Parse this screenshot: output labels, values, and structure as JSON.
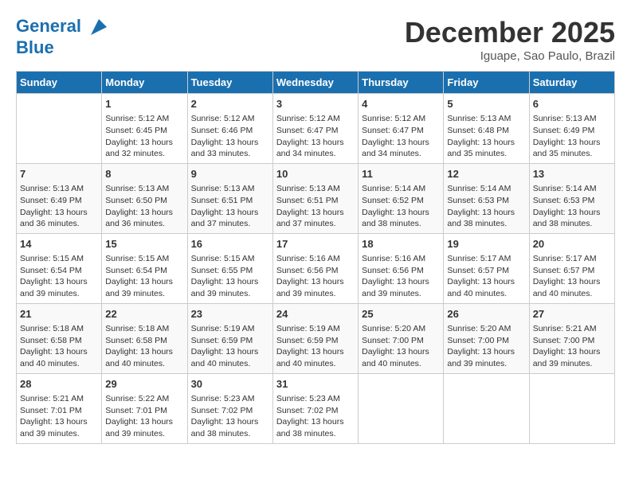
{
  "header": {
    "logo_line1": "General",
    "logo_line2": "Blue",
    "month": "December 2025",
    "location": "Iguape, Sao Paulo, Brazil"
  },
  "weekdays": [
    "Sunday",
    "Monday",
    "Tuesday",
    "Wednesday",
    "Thursday",
    "Friday",
    "Saturday"
  ],
  "weeks": [
    [
      {
        "day": "",
        "info": ""
      },
      {
        "day": "1",
        "info": "Sunrise: 5:12 AM\nSunset: 6:45 PM\nDaylight: 13 hours\nand 32 minutes."
      },
      {
        "day": "2",
        "info": "Sunrise: 5:12 AM\nSunset: 6:46 PM\nDaylight: 13 hours\nand 33 minutes."
      },
      {
        "day": "3",
        "info": "Sunrise: 5:12 AM\nSunset: 6:47 PM\nDaylight: 13 hours\nand 34 minutes."
      },
      {
        "day": "4",
        "info": "Sunrise: 5:12 AM\nSunset: 6:47 PM\nDaylight: 13 hours\nand 34 minutes."
      },
      {
        "day": "5",
        "info": "Sunrise: 5:13 AM\nSunset: 6:48 PM\nDaylight: 13 hours\nand 35 minutes."
      },
      {
        "day": "6",
        "info": "Sunrise: 5:13 AM\nSunset: 6:49 PM\nDaylight: 13 hours\nand 35 minutes."
      }
    ],
    [
      {
        "day": "7",
        "info": "Sunrise: 5:13 AM\nSunset: 6:49 PM\nDaylight: 13 hours\nand 36 minutes."
      },
      {
        "day": "8",
        "info": "Sunrise: 5:13 AM\nSunset: 6:50 PM\nDaylight: 13 hours\nand 36 minutes."
      },
      {
        "day": "9",
        "info": "Sunrise: 5:13 AM\nSunset: 6:51 PM\nDaylight: 13 hours\nand 37 minutes."
      },
      {
        "day": "10",
        "info": "Sunrise: 5:13 AM\nSunset: 6:51 PM\nDaylight: 13 hours\nand 37 minutes."
      },
      {
        "day": "11",
        "info": "Sunrise: 5:14 AM\nSunset: 6:52 PM\nDaylight: 13 hours\nand 38 minutes."
      },
      {
        "day": "12",
        "info": "Sunrise: 5:14 AM\nSunset: 6:53 PM\nDaylight: 13 hours\nand 38 minutes."
      },
      {
        "day": "13",
        "info": "Sunrise: 5:14 AM\nSunset: 6:53 PM\nDaylight: 13 hours\nand 38 minutes."
      }
    ],
    [
      {
        "day": "14",
        "info": "Sunrise: 5:15 AM\nSunset: 6:54 PM\nDaylight: 13 hours\nand 39 minutes."
      },
      {
        "day": "15",
        "info": "Sunrise: 5:15 AM\nSunset: 6:54 PM\nDaylight: 13 hours\nand 39 minutes."
      },
      {
        "day": "16",
        "info": "Sunrise: 5:15 AM\nSunset: 6:55 PM\nDaylight: 13 hours\nand 39 minutes."
      },
      {
        "day": "17",
        "info": "Sunrise: 5:16 AM\nSunset: 6:56 PM\nDaylight: 13 hours\nand 39 minutes."
      },
      {
        "day": "18",
        "info": "Sunrise: 5:16 AM\nSunset: 6:56 PM\nDaylight: 13 hours\nand 39 minutes."
      },
      {
        "day": "19",
        "info": "Sunrise: 5:17 AM\nSunset: 6:57 PM\nDaylight: 13 hours\nand 40 minutes."
      },
      {
        "day": "20",
        "info": "Sunrise: 5:17 AM\nSunset: 6:57 PM\nDaylight: 13 hours\nand 40 minutes."
      }
    ],
    [
      {
        "day": "21",
        "info": "Sunrise: 5:18 AM\nSunset: 6:58 PM\nDaylight: 13 hours\nand 40 minutes."
      },
      {
        "day": "22",
        "info": "Sunrise: 5:18 AM\nSunset: 6:58 PM\nDaylight: 13 hours\nand 40 minutes."
      },
      {
        "day": "23",
        "info": "Sunrise: 5:19 AM\nSunset: 6:59 PM\nDaylight: 13 hours\nand 40 minutes."
      },
      {
        "day": "24",
        "info": "Sunrise: 5:19 AM\nSunset: 6:59 PM\nDaylight: 13 hours\nand 40 minutes."
      },
      {
        "day": "25",
        "info": "Sunrise: 5:20 AM\nSunset: 7:00 PM\nDaylight: 13 hours\nand 40 minutes."
      },
      {
        "day": "26",
        "info": "Sunrise: 5:20 AM\nSunset: 7:00 PM\nDaylight: 13 hours\nand 39 minutes."
      },
      {
        "day": "27",
        "info": "Sunrise: 5:21 AM\nSunset: 7:00 PM\nDaylight: 13 hours\nand 39 minutes."
      }
    ],
    [
      {
        "day": "28",
        "info": "Sunrise: 5:21 AM\nSunset: 7:01 PM\nDaylight: 13 hours\nand 39 minutes."
      },
      {
        "day": "29",
        "info": "Sunrise: 5:22 AM\nSunset: 7:01 PM\nDaylight: 13 hours\nand 39 minutes."
      },
      {
        "day": "30",
        "info": "Sunrise: 5:23 AM\nSunset: 7:02 PM\nDaylight: 13 hours\nand 38 minutes."
      },
      {
        "day": "31",
        "info": "Sunrise: 5:23 AM\nSunset: 7:02 PM\nDaylight: 13 hours\nand 38 minutes."
      },
      {
        "day": "",
        "info": ""
      },
      {
        "day": "",
        "info": ""
      },
      {
        "day": "",
        "info": ""
      }
    ]
  ]
}
